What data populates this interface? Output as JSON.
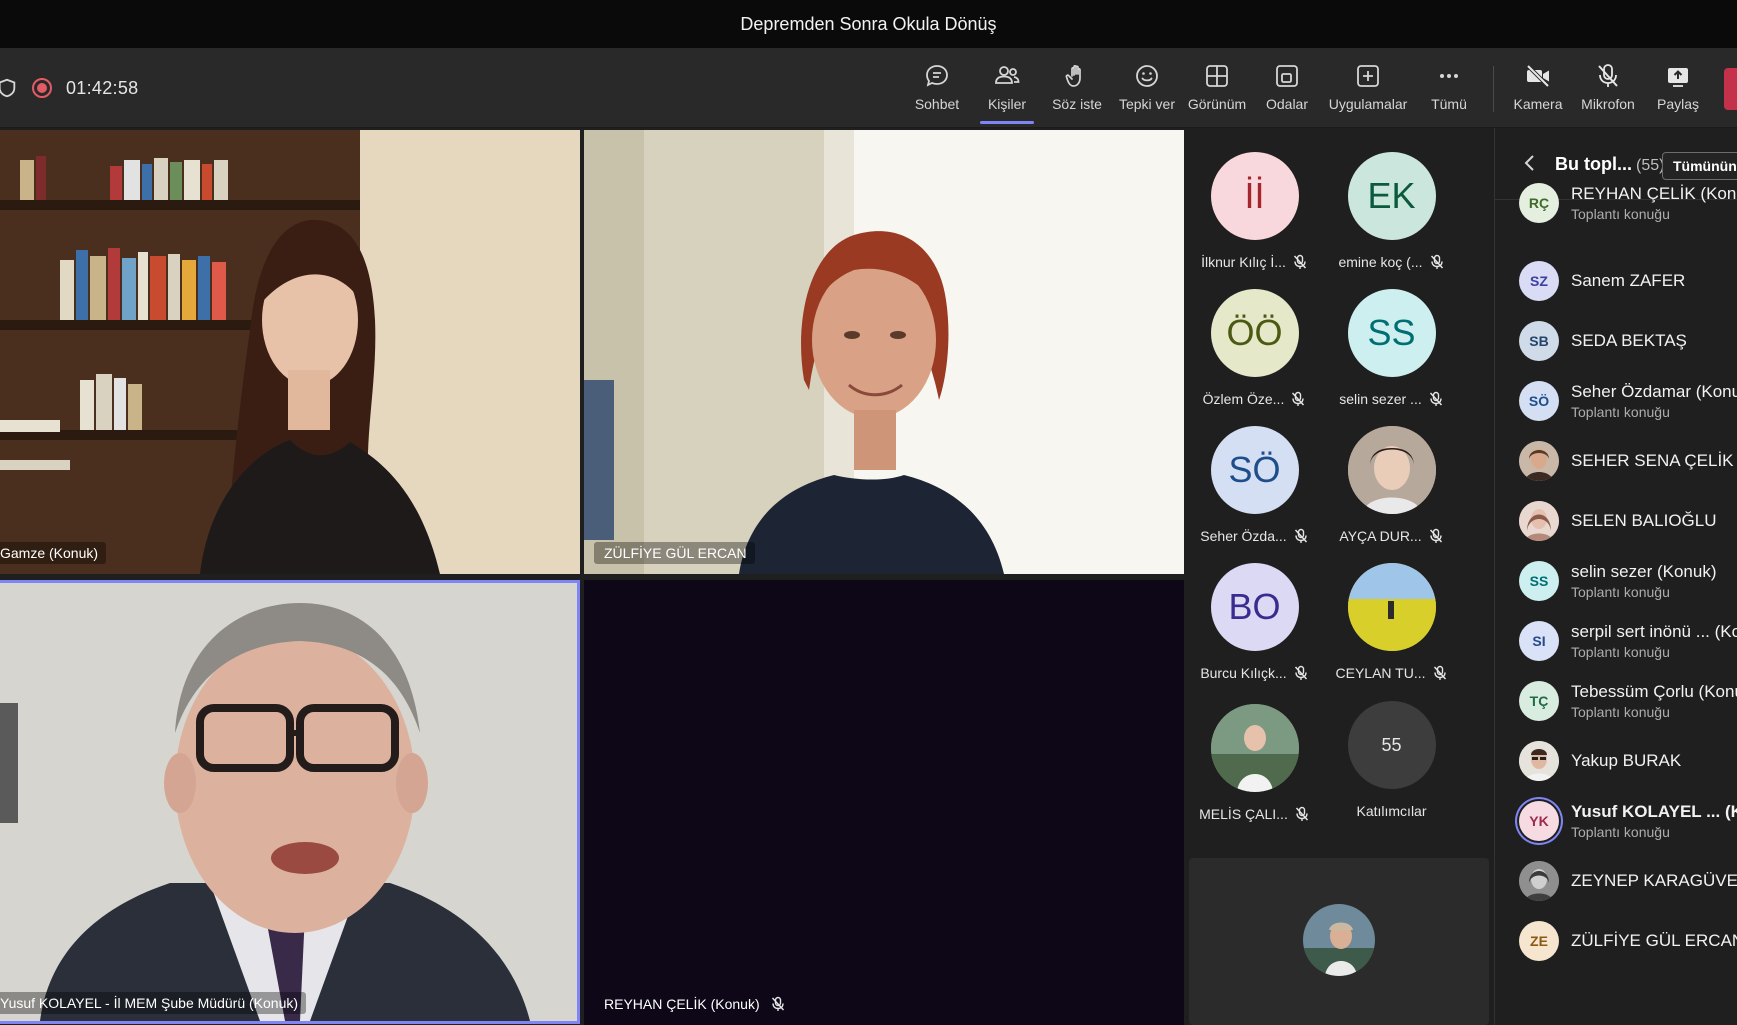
{
  "window": {
    "title": "Depremden Sonra Okula Dönüş"
  },
  "meeting": {
    "timer": "01:42:58"
  },
  "colors": {
    "accent": "#7f85f5",
    "record": "#e35b66",
    "leave": "#c4314b"
  },
  "toolbar": {
    "items": [
      {
        "label": "Sohbet",
        "icon": "chat-icon"
      },
      {
        "label": "Kişiler",
        "icon": "people-icon"
      },
      {
        "label": "Söz iste",
        "icon": "raise-hand-icon"
      },
      {
        "label": "Tepki ver",
        "icon": "reaction-icon"
      },
      {
        "label": "Görünüm",
        "icon": "view-grid-icon"
      },
      {
        "label": "Odalar",
        "icon": "rooms-icon"
      },
      {
        "label": "Uygulamalar",
        "icon": "apps-icon"
      },
      {
        "label": "Tümü",
        "icon": "more-icon"
      },
      {
        "label": "Kamera",
        "icon": "camera-off-icon"
      },
      {
        "label": "Mikrofon",
        "icon": "mic-off-icon"
      },
      {
        "label": "Paylaş",
        "icon": "share-icon"
      }
    ]
  },
  "video_tiles": [
    {
      "name": "Gamze (Konuk)"
    },
    {
      "name": "ZÜLFİYE GÜL ERCAN"
    },
    {
      "name": "Yusuf KOLAYEL - İl MEM Şube Müdürü (Konuk)"
    },
    {
      "name": "REYHAN ÇELİK (Konuk)"
    }
  ],
  "gallery": {
    "items": [
      {
        "initials": "İİ",
        "label": "İlknur Kılıç İ...",
        "bg": "#f8d8dc",
        "fg": "#a4262c"
      },
      {
        "initials": "EK",
        "label": "emine koç (...",
        "bg": "#cbe6dc",
        "fg": "#0b5a3d"
      },
      {
        "initials": "ÖÖ",
        "label": "Özlem Öze...",
        "bg": "#e5e8c9",
        "fg": "#4a5a12"
      },
      {
        "initials": "SS",
        "label": "selin sezer ...",
        "bg": "#cdeff0",
        "fg": "#006f73"
      },
      {
        "initials": "SÖ",
        "label": "Seher Özda...",
        "bg": "#d4dff3",
        "fg": "#1e4d8c"
      },
      {
        "initials": "",
        "label": "AYÇA DUR...",
        "bg": "#c7b9ae",
        "fg": "#333"
      },
      {
        "initials": "BO",
        "label": "Burcu Kılıçk...",
        "bg": "#dcd9f5",
        "fg": "#3b2b8f"
      },
      {
        "initials": "",
        "label": "CEYLAN TU...",
        "bg": "#b9c24a",
        "fg": "#333"
      },
      {
        "initials": "",
        "label": "MELİS ÇALI...",
        "bg": "#6f8a6a",
        "fg": "#fff"
      },
      {
        "initials": "55",
        "label": "Katılımcılar",
        "bg": "#3d3d3d",
        "fg": "#e6e6e6"
      }
    ]
  },
  "panel": {
    "title": "Bu topl...",
    "count": "(55)",
    "mute_all_label": "Tümünün",
    "participants": [
      {
        "initials": "RÇ",
        "name": "REYHAN ÇELİK (Konuk)",
        "sub": "Toplantı konuğu",
        "bg": "#e4efe0",
        "fg": "#3c6b2a"
      },
      {
        "initials": "SZ",
        "name": "Sanem ZAFER",
        "sub": "",
        "bg": "#d9dcf4",
        "fg": "#3b3f9e"
      },
      {
        "initials": "SB",
        "name": "SEDA BEKTAŞ",
        "sub": "",
        "bg": "#cfdbe8",
        "fg": "#24466b"
      },
      {
        "initials": "SÖ",
        "name": "Seher Özdamar (Konuk)",
        "sub": "Toplantı konuğu",
        "bg": "#d4dff3",
        "fg": "#1e4d8c"
      },
      {
        "initials": "",
        "name": "SEHER SENA ÇELİK",
        "sub": "",
        "bg": "#8a6d5a",
        "fg": "#fff"
      },
      {
        "initials": "",
        "name": "SELEN BALIOĞLU",
        "sub": "",
        "bg": "#c9a49a",
        "fg": "#fff"
      },
      {
        "initials": "SS",
        "name": "selin sezer (Konuk)",
        "sub": "Toplantı konuğu",
        "bg": "#cdeff0",
        "fg": "#006f73"
      },
      {
        "initials": "SI",
        "name": "serpil sert inönü ... (Konuk)",
        "sub": "Toplantı konuğu",
        "bg": "#d9e2f6",
        "fg": "#264a8c"
      },
      {
        "initials": "TÇ",
        "name": "Tebessüm Çorlu (Konuk)",
        "sub": "Toplantı konuğu",
        "bg": "#d8ece0",
        "fg": "#1f6b43"
      },
      {
        "initials": "",
        "name": "Yakup BURAK",
        "sub": "",
        "bg": "#d8cfc6",
        "fg": "#333"
      },
      {
        "initials": "YK",
        "name": "Yusuf KOLAYEL ...  (Konuk)",
        "sub": "Toplantı konuğu",
        "bg": "#f6dbe3",
        "fg": "#9c2a4a"
      },
      {
        "initials": "",
        "name": "ZEYNEP KARAGÜVEN",
        "sub": "",
        "bg": "#6c6c6c",
        "fg": "#fff"
      },
      {
        "initials": "ZE",
        "name": "ZÜLFİYE GÜL ERCAN",
        "sub": "",
        "bg": "#f7e6cf",
        "fg": "#8a5a12"
      }
    ]
  }
}
